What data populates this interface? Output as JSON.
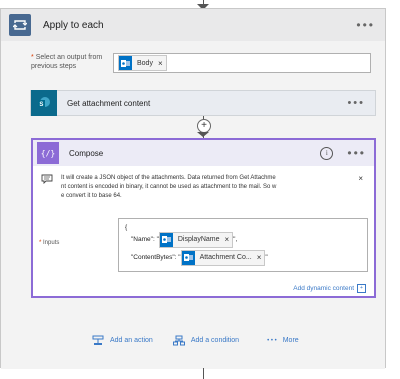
{
  "loop": {
    "title": "Apply to each",
    "menu": "•••",
    "select_label": "Select an output from previous steps",
    "required_mark": "*",
    "token": {
      "label": "Body",
      "remove": "×"
    }
  },
  "get_attachment": {
    "title": "Get attachment content",
    "menu": "•••"
  },
  "insert_step": "+",
  "compose": {
    "title": "Compose",
    "icon_text": "{/}",
    "info": "i",
    "menu": "•••",
    "comment_line1": "It will create a JSON object of the attachments. Data returned from Get Attachme",
    "comment_line2": "nt content is encoded in binary, it cannot be used as attachment to the mail. So w",
    "comment_line3": "e convert it to base 64.",
    "comment_close": "×",
    "inputs_label": "Inputs",
    "required_mark": "*",
    "json_open": "{",
    "name_key": "\"Name\": \"",
    "name_token": "DisplayName",
    "name_tail": "\",",
    "bytes_key": "\"ContentBytes\": \"",
    "bytes_token": "Attachment Co...",
    "bytes_tail": "\"",
    "token_remove": "×",
    "add_dynamic": "Add dynamic content",
    "add_dynamic_icon": "+"
  },
  "footer": {
    "add_action": "Add an action",
    "add_condition": "Add a condition",
    "more": "More",
    "more_dots": "• • •"
  },
  "colors": {
    "loop_icon": "#486991",
    "outlook": "#0072c6",
    "sharepoint": "#0b6a8c",
    "compose_accent": "#8c6bd6",
    "link": "#3a79c7"
  }
}
